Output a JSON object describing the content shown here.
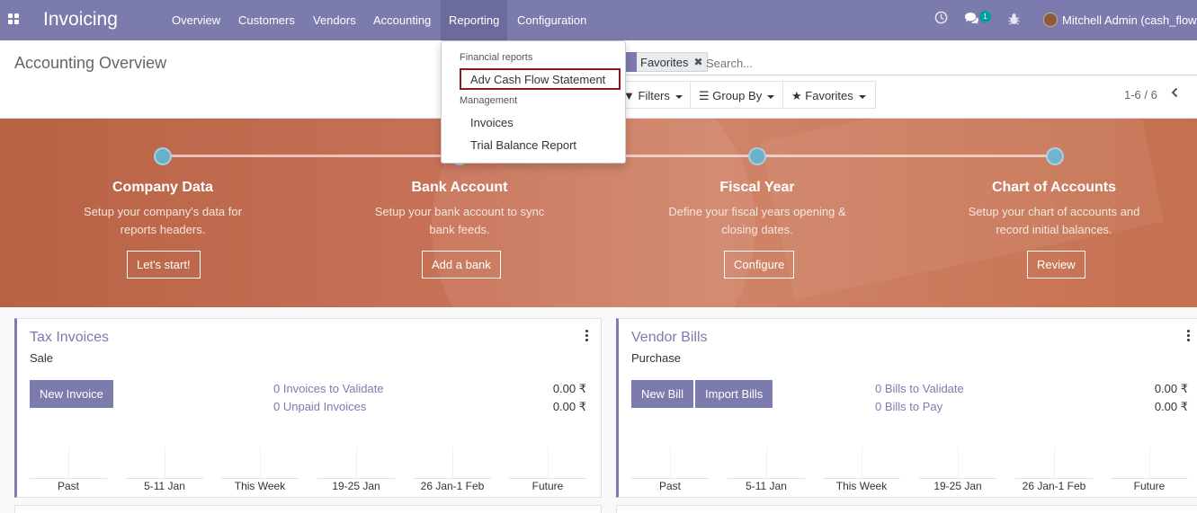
{
  "navbar": {
    "brand": "Invoicing",
    "menus": [
      "Overview",
      "Customers",
      "Vendors",
      "Accounting",
      "Reporting",
      "Configuration"
    ],
    "active_menu": "Reporting",
    "messages_count": "1",
    "user": "Mitchell Admin (cash_flow"
  },
  "control_panel": {
    "title": "Accounting Overview",
    "facet_label": "Favorites",
    "search_placeholder": "Search...",
    "filters_label": "Filters",
    "groupby_label": "Group By",
    "favorites_label": "Favorites",
    "pager": "1-6 / 6"
  },
  "reporting_dropdown": {
    "section1": "Financial reports",
    "item1": "Adv Cash Flow Statement",
    "section2": "Management",
    "item2": "Invoices",
    "item3": "Trial Balance Report"
  },
  "onboarding": {
    "steps": [
      {
        "title": "Company Data",
        "line1": "Setup your company's data for",
        "line2": "reports headers.",
        "button": "Let's start!"
      },
      {
        "title": "Bank Account",
        "line1": "Setup your bank account to sync",
        "line2": "bank feeds.",
        "button": "Add a bank"
      },
      {
        "title": "Fiscal Year",
        "line1": "Define your fiscal years opening &",
        "line2": "closing dates.",
        "button": "Configure"
      },
      {
        "title": "Chart of Accounts",
        "line1": "Setup your chart of accounts and",
        "line2": "record initial balances.",
        "button": "Review"
      }
    ]
  },
  "cards": [
    {
      "name": "Tax Invoices",
      "type": "Sale",
      "buttons": [
        "New Invoice"
      ],
      "link1": "0 Invoices to Validate",
      "amount1": "0.00 ₹",
      "link2": "0 Unpaid Invoices",
      "amount2": "0.00 ₹"
    },
    {
      "name": "Vendor Bills",
      "type": "Purchase",
      "buttons": [
        "New Bill",
        "Import Bills"
      ],
      "link1": "0 Bills to Validate",
      "amount1": "0.00 ₹",
      "link2": "0 Bills to Pay",
      "amount2": "0.00 ₹"
    }
  ],
  "graph_labels": [
    "Past",
    "5-11 Jan",
    "This Week",
    "19-25 Jan",
    "26 Jan-1 Feb",
    "Future"
  ],
  "colors": {
    "brand": "#7c7bad",
    "highlight": "#8b1a1a",
    "banner": "#c87358",
    "step_dot": "#6ab0c8"
  }
}
